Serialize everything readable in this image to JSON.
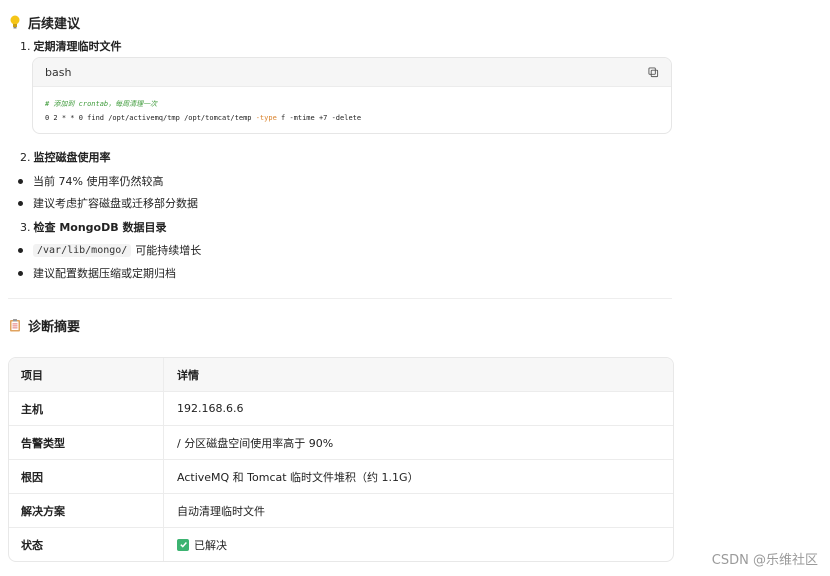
{
  "section_suggest": {
    "title": "后续建议",
    "icon": "lightbulb-icon"
  },
  "step1": {
    "num": "1.",
    "label": "定期清理临时文件"
  },
  "code": {
    "lang": "bash",
    "comment": "# 添加到 crontab，每周清理一次",
    "cmd_prefix": "0 2 * * 0 find /opt/activemq/tmp /opt/tomcat/temp ",
    "cmd_kw": "-type",
    "cmd_suffix": " f -mtime +7 -delete"
  },
  "step2": {
    "num": "2.",
    "label": "监控磁盘使用率"
  },
  "bullets_a": [
    "当前 74% 使用率仍然较高",
    "建议考虑扩容磁盘或迁移部分数据"
  ],
  "step3": {
    "num": "3.",
    "label": "检查 MongoDB 数据目录"
  },
  "bullets_b": {
    "code": "/var/lib/mongo/",
    "text": "可能持续增长"
  },
  "bullet_c": "建议配置数据压缩或定期归档",
  "section_summary": {
    "title": "诊断摘要",
    "icon": "clipboard-icon"
  },
  "table": {
    "headers": [
      "项目",
      "详情"
    ],
    "rows": [
      [
        "主机",
        "192.168.6.6"
      ],
      [
        "告警类型",
        "/ 分区磁盘空间使用率高于 90%"
      ],
      [
        "根因",
        "ActiveMQ 和 Tomcat 临时文件堆积（约 1.1G）"
      ],
      [
        "解决方案",
        "自动清理临时文件"
      ],
      [
        "状态",
        "已解决"
      ]
    ]
  },
  "watermark": "CSDN @乐维社区"
}
